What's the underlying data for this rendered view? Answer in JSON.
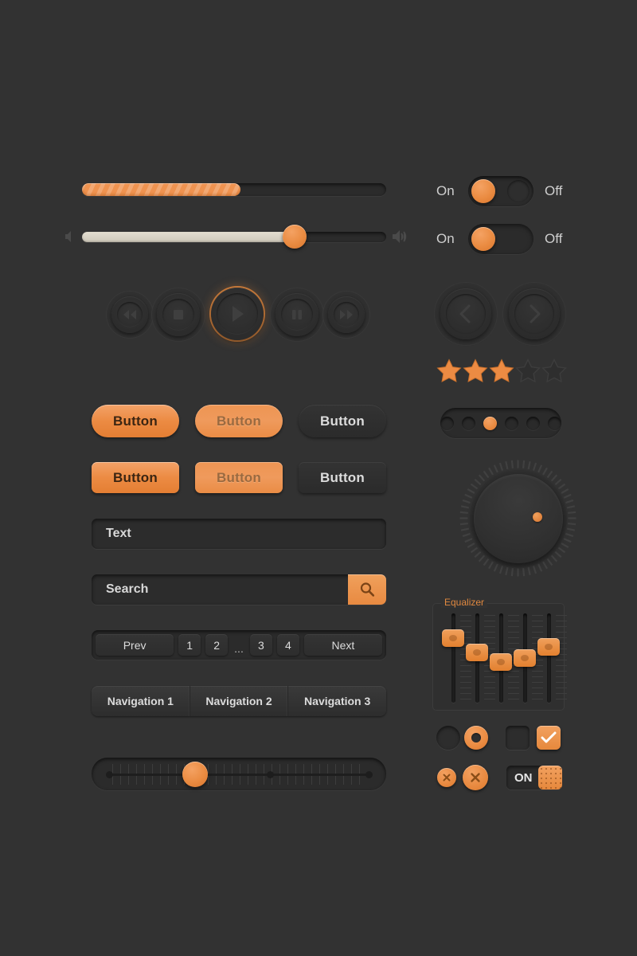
{
  "theme": {
    "background": "#323232",
    "accent": "#ea8b41",
    "accent_light": "#f4a263",
    "control_dark": "#2b2b2b",
    "text": "#dcdcdc",
    "text_muted": "#9a6a40"
  },
  "progress": {
    "name": "striped-progress-bar",
    "value_percent": 52,
    "fill_style": "diagonal-stripes"
  },
  "volume": {
    "name": "volume-slider",
    "value_percent": 70,
    "icon_left": "speaker-mute-icon",
    "icon_right": "speaker-volume-icon"
  },
  "media_controls": {
    "buttons": [
      {
        "name": "rewind-button",
        "icon": "rewind-icon",
        "size": 46,
        "active": false
      },
      {
        "name": "stop-button",
        "icon": "stop-icon",
        "size": 54,
        "active": false
      },
      {
        "name": "play-button",
        "icon": "play-icon",
        "size": 66,
        "active": true
      },
      {
        "name": "pause-button",
        "icon": "pause-icon",
        "size": 54,
        "active": false
      },
      {
        "name": "fast-forward-button",
        "icon": "fast-forward-icon",
        "size": 46,
        "active": false
      }
    ]
  },
  "toggles": [
    {
      "name": "toggle-switch-1",
      "on_label": "On",
      "off_label": "Off",
      "state": "on",
      "style": "hard"
    },
    {
      "name": "toggle-switch-2",
      "on_label": "On",
      "off_label": "Off",
      "state": "on",
      "style": "soft"
    }
  ],
  "arrow_nav": {
    "prev": {
      "name": "prev-arrow-button",
      "icon": "chevron-left-icon"
    },
    "next": {
      "name": "next-arrow-button",
      "icon": "chevron-right-icon"
    }
  },
  "rating": {
    "name": "star-rating",
    "value": 3,
    "max": 5,
    "icon": "star-icon"
  },
  "dots_pager": {
    "name": "dots-pager",
    "count": 6,
    "active_index": 2
  },
  "knob": {
    "name": "rotary-knob",
    "indicator_angle_deg": 45,
    "tick_count": 60
  },
  "buttons_row_1": [
    {
      "name": "button-pill-primary",
      "label": "Button",
      "style": "orange",
      "shape": "pill"
    },
    {
      "name": "button-pill-disabled",
      "label": "Button",
      "style": "orange-muted",
      "shape": "pill"
    },
    {
      "name": "button-pill-ghost",
      "label": "Button",
      "style": "ghost",
      "shape": "pill"
    }
  ],
  "buttons_row_2": [
    {
      "name": "button-rect-primary",
      "label": "Button",
      "style": "orange",
      "shape": "rect"
    },
    {
      "name": "button-rect-disabled",
      "label": "Button",
      "style": "orange-muted",
      "shape": "rect"
    },
    {
      "name": "button-rect-ghost",
      "label": "Button",
      "style": "ghost",
      "shape": "rect"
    }
  ],
  "text_input": {
    "name": "text-input",
    "value": "Text",
    "placeholder": "Text"
  },
  "search_input": {
    "name": "search-input",
    "value": "Search",
    "placeholder": "Search",
    "button_name": "search-button",
    "button_icon": "search-icon"
  },
  "pagination": {
    "name": "pagination",
    "items": [
      {
        "label": "Prev",
        "name": "pagination-prev",
        "wide": true
      },
      {
        "label": "1",
        "name": "pagination-page-1",
        "wide": false
      },
      {
        "label": "2",
        "name": "pagination-page-2",
        "wide": false
      },
      {
        "label": "...",
        "name": "pagination-ellipsis",
        "wide": false
      },
      {
        "label": "3",
        "name": "pagination-page-3",
        "wide": false
      },
      {
        "label": "4",
        "name": "pagination-page-4",
        "wide": false
      },
      {
        "label": "Next",
        "name": "pagination-next",
        "wide": true
      }
    ]
  },
  "navbar": {
    "name": "navigation-bar",
    "items": [
      {
        "label": "Navigation 1",
        "name": "nav-item-1"
      },
      {
        "label": "Navigation 2",
        "name": "nav-item-2"
      },
      {
        "label": "Navigation 3",
        "name": "nav-item-3"
      }
    ]
  },
  "ruler_slider": {
    "name": "ruler-slider",
    "value_percent": 33,
    "node_positions_percent": [
      0,
      62,
      100
    ]
  },
  "equalizer": {
    "name": "equalizer-panel",
    "legend": "Equalizer",
    "bands": [
      {
        "name": "eq-band-1",
        "value_percent": 78
      },
      {
        "name": "eq-band-2",
        "value_percent": 58
      },
      {
        "name": "eq-band-3",
        "value_percent": 45
      },
      {
        "name": "eq-band-4",
        "value_percent": 50
      },
      {
        "name": "eq-band-5",
        "value_percent": 66
      }
    ]
  },
  "form_controls": {
    "radios": [
      {
        "name": "radio-unchecked",
        "checked": false
      },
      {
        "name": "radio-checked",
        "checked": true
      }
    ],
    "checkboxes": [
      {
        "name": "checkbox-unchecked",
        "checked": false,
        "icon": "check-icon"
      },
      {
        "name": "checkbox-checked",
        "checked": true,
        "icon": "check-icon"
      }
    ],
    "close_buttons": [
      {
        "name": "close-button-small",
        "icon": "close-icon",
        "size": 24
      },
      {
        "name": "close-button-large",
        "icon": "close-icon",
        "size": 32
      }
    ],
    "on_switch": {
      "name": "on-switch",
      "label": "ON",
      "grip_icon": "grip-dots-icon"
    }
  }
}
